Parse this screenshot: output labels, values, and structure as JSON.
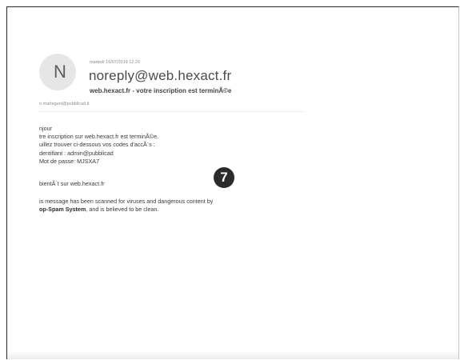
{
  "email": {
    "avatar_initial": "N",
    "date": "martedì 16/07/2019 12:29",
    "sender": "noreply@web.hexact.fr",
    "subject": "web.hexact.fr  - votre inscription est terminÃ©e",
    "recipient": "n.martegani@pubblicad.it",
    "body": {
      "greeting": "njour",
      "line1": "tre inscription sur web.hexact.fr est terminÃ©e.",
      "line2": "uillez trouver ci-dessous vos codes d'accÃ¨s :",
      "line3": "dentifiant : admin@pubblicad",
      "line4": "Mot de passe: MJSXA7",
      "line5": "bientÃ´t sur web.hexact.fr",
      "scan_line1": "is message has been scanned for viruses and dangerous content by",
      "scan_line2_bold": "op-Spam System",
      "scan_line2_rest": ", and is believed to be clean."
    }
  },
  "annotation": {
    "badge_number": "7",
    "badge_color": "#2b2b2b"
  }
}
